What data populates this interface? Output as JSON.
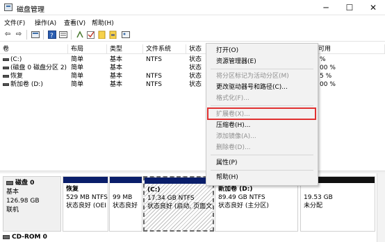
{
  "window": {
    "title": "磁盘管理",
    "min_icon": "─",
    "max_icon": "☐",
    "close_icon": "✕"
  },
  "menubar": {
    "items": [
      "文件(F)",
      "操作(A)",
      "查看(V)",
      "帮助(H)"
    ]
  },
  "toolbar": {
    "icons": [
      "back-arrow-icon",
      "forward-arrow-icon",
      "console-icon",
      "help-icon",
      "properties-icon",
      "connect-icon",
      "check-icon",
      "folder-icon",
      "disk-icon",
      "image-icon"
    ]
  },
  "table": {
    "headers": [
      "卷",
      "布局",
      "类型",
      "文件系统",
      "状态",
      "可用"
    ],
    "rows": [
      {
        "volume": "(C:)",
        "layout": "简单",
        "type": "基本",
        "fs": "NTFS",
        "status": "状态",
        "free": "% "
      },
      {
        "volume": "(磁盘 0 磁盘分区 2)",
        "layout": "简单",
        "type": "基本",
        "fs": "",
        "status": "状态",
        "free": "00 %"
      },
      {
        "volume": "恢复",
        "layout": "简单",
        "type": "基本",
        "fs": "NTFS",
        "status": "状态",
        "free": "5 %"
      },
      {
        "volume": "新加卷 (D:)",
        "layout": "简单",
        "type": "基本",
        "fs": "NTFS",
        "status": "状态",
        "free": "00 %"
      }
    ]
  },
  "context_menu": {
    "items": [
      {
        "label": "打开(O)",
        "enabled": true
      },
      {
        "label": "资源管理器(E)",
        "enabled": true
      },
      {
        "label": "将分区标记为活动分区(M)",
        "enabled": false
      },
      {
        "label": "更改驱动器号和路径(C)...",
        "enabled": true
      },
      {
        "label": "格式化(F)...",
        "enabled": false
      },
      {
        "label": "扩展卷(X)...",
        "enabled": false
      },
      {
        "label": "压缩卷(H)...",
        "enabled": true
      },
      {
        "label": "添加镜像(A)...",
        "enabled": false
      },
      {
        "label": "删除卷(D)...",
        "enabled": false
      },
      {
        "label": "属性(P)",
        "enabled": true
      },
      {
        "label": "帮助(H)",
        "enabled": true
      }
    ]
  },
  "disk0": {
    "name": "磁盘 0",
    "type": "基本",
    "size": "126.98 GB",
    "status": "联机",
    "partitions": [
      {
        "name": "恢复",
        "size": "529 MB NTFS",
        "status": "状态良好 (OEI"
      },
      {
        "name": "",
        "size": "99 MB",
        "status": "状态良好"
      },
      {
        "name": "(C:)",
        "size": "17.34 GB NTFS",
        "status": "状态良好 (启动, 页面文件"
      },
      {
        "name": "新加卷 (D:)",
        "size": "89.49 GB NTFS",
        "status": "状态良好 (主分区)"
      },
      {
        "name": "",
        "size": "19.53 GB",
        "status": "未分配"
      }
    ]
  },
  "cdrom": {
    "name": "CD-ROM 0"
  },
  "colors": {
    "primary_partition": "#0a1e6a",
    "unallocated": "#111111",
    "highlight_box": "#e03030"
  }
}
